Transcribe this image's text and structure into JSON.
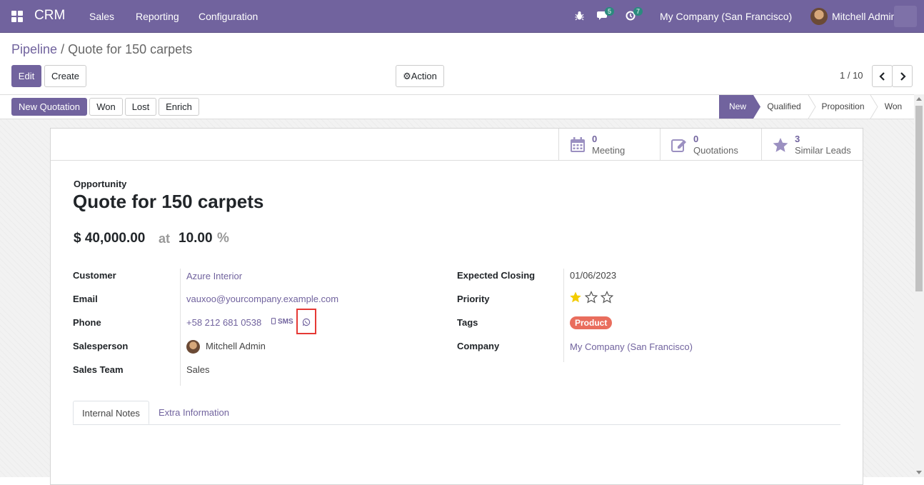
{
  "navbar": {
    "app_name": "CRM",
    "menu": [
      "Sales",
      "Reporting",
      "Configuration"
    ],
    "messages_count": "5",
    "activities_count": "7",
    "company": "My Company (San Francisco)",
    "user": "Mitchell Admin"
  },
  "breadcrumb": {
    "parent": "Pipeline",
    "separator": "/",
    "current": "Quote for 150 carpets"
  },
  "controls": {
    "edit": "Edit",
    "create": "Create",
    "action": "Action",
    "pager": "1 / 10"
  },
  "header_buttons": {
    "new_quotation": "New Quotation",
    "won": "Won",
    "lost": "Lost",
    "enrich": "Enrich"
  },
  "stages": [
    {
      "label": "New",
      "active": true
    },
    {
      "label": "Qualified",
      "active": false
    },
    {
      "label": "Proposition",
      "active": false
    },
    {
      "label": "Won",
      "active": false
    }
  ],
  "smart_buttons": {
    "meeting": {
      "count": "0",
      "label": "Meeting",
      "icon": "calendar-icon"
    },
    "quotations": {
      "count": "0",
      "label": "Quotations",
      "icon": "pencil-square-icon"
    },
    "similar": {
      "count": "3",
      "label": "Similar Leads",
      "icon": "star-icon"
    }
  },
  "record": {
    "type_label": "Opportunity",
    "title": "Quote for 150 carpets",
    "revenue": "$ 40,000.00",
    "at": "at",
    "probability": "10.00",
    "percent": "%"
  },
  "left_fields": {
    "customer_label": "Customer",
    "customer": "Azure Interior",
    "email_label": "Email",
    "email": "vauxoo@yourcompany.example.com",
    "phone_label": "Phone",
    "phone": "+58 212 681 0538",
    "sms": "SMS",
    "salesperson_label": "Salesperson",
    "salesperson": "Mitchell Admin",
    "team_label": "Sales Team",
    "team": "Sales"
  },
  "right_fields": {
    "closing_label": "Expected Closing",
    "closing": "01/06/2023",
    "priority_label": "Priority",
    "priority_stars": 1,
    "priority_max": 3,
    "tags_label": "Tags",
    "tag": "Product",
    "company_label": "Company",
    "company": "My Company (San Francisco)"
  },
  "tabs": {
    "notes": "Internal Notes",
    "extra": "Extra Information"
  },
  "colors": {
    "brand": "#71639e",
    "tag": "#e96d5d",
    "highlight": "#e53935",
    "star": "#f3cc00"
  }
}
